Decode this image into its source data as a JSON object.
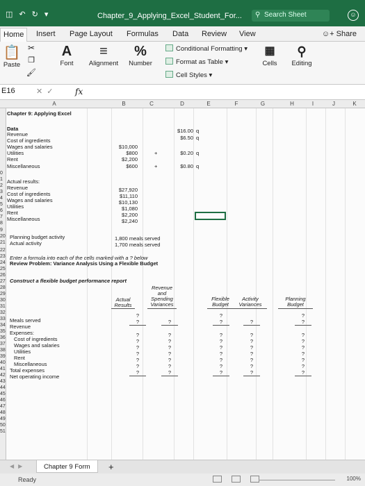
{
  "window": {
    "title": "Chapter_9_Applying_Excel_Student_For...",
    "search_placeholder": "Search Sheet"
  },
  "tabs": [
    "Home",
    "Insert",
    "Page Layout",
    "Formulas",
    "Data",
    "Review",
    "View"
  ],
  "share_label": "Share",
  "ribbon": {
    "paste": "Paste",
    "font": "Font",
    "alignment": "Alignment",
    "number": "Number",
    "conditional_formatting": "Conditional Formatting",
    "format_as_table": "Format as Table",
    "cell_styles": "Cell Styles",
    "cells": "Cells",
    "editing": "Editing"
  },
  "formula_bar": {
    "name_box": "E16",
    "fx": "fx",
    "value": ""
  },
  "columns": [
    "A",
    "B",
    "C",
    "D",
    "E",
    "F",
    "G",
    "H",
    "I",
    "J",
    "K"
  ],
  "sheet": {
    "title": "Chapter 9: Applying Excel",
    "data_label": "Data",
    "revenue_label": "Revenue",
    "cost_ingredients_label": "Cost of ingredients",
    "wages_label": "Wages and salaries",
    "utilities_label": "Utilities",
    "rent_label": "Rent",
    "misc_label": "Miscellaneous",
    "revenue_rate": "$16.00",
    "ingredients_rate": "$6.50",
    "wages_fixed": "$10,000",
    "utilities_fixed": "$800",
    "utilities_rate": "$0.20",
    "rent_fixed": "$2,200",
    "misc_fixed": "$600",
    "misc_rate": "$0.80",
    "q": "q",
    "plus": "+",
    "actual_results_label": "Actual results:",
    "actual_revenue": "$27,920",
    "actual_ingredients": "$11,110",
    "actual_wages": "$10,130",
    "actual_utilities": "$1,080",
    "actual_rent": "$2,200",
    "actual_misc": "$2,240",
    "planning_activity_label": "Planning budget activity",
    "planning_activity_value": "1,800 meals served",
    "actual_activity_label": "Actual activity",
    "actual_activity_value": "1,700 meals served",
    "instruction": "Enter a formula into each of the cells marked with a ? below",
    "review_problem": "Review Problem: Variance Analysis Using a Flexible Budget",
    "construct_label": "Construct a flexible budget performance report",
    "hdr_actual_results": [
      "Actual",
      "Results"
    ],
    "hdr_revenue_spending": [
      "Revenue",
      "and",
      "Spending",
      "Variances"
    ],
    "hdr_flexible_budget": [
      "Flexible",
      "Budget"
    ],
    "hdr_activity_variances": [
      "Activity",
      "Variances"
    ],
    "hdr_planning_budget": [
      "Planning",
      "Budget"
    ],
    "meals_served_label": "Meals served",
    "expenses_label": "Expenses:",
    "total_expenses_label": "Total expenses",
    "net_income_label": "Net operating income",
    "placeholder": "?"
  },
  "row_numbers_top": [
    "16"
  ],
  "row_numbers": [
    "0",
    "1",
    "2",
    "3",
    "4",
    "5",
    "6",
    "7",
    "8",
    "9",
    "20",
    "21",
    "22",
    "23",
    "24",
    "25",
    "26",
    "27",
    "28",
    "29",
    "30",
    "31",
    "32",
    "33",
    "34",
    "35",
    "36",
    "37",
    "38",
    "39",
    "40",
    "41",
    "42",
    "43",
    "44",
    "45",
    "46",
    "47",
    "48",
    "49",
    "50",
    "51"
  ],
  "sheet_tab": "Chapter 9 Form",
  "add_sheet": "+",
  "status": {
    "ready": "Ready",
    "zoom": "100%"
  }
}
